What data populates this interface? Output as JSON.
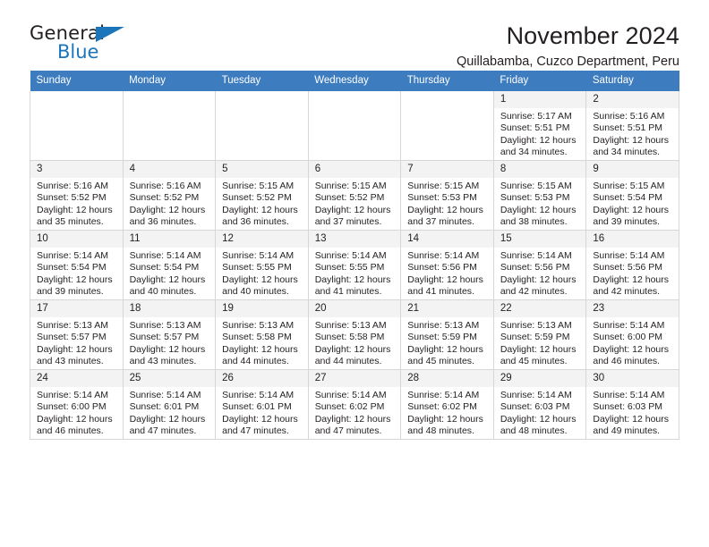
{
  "brand": {
    "word1": "General",
    "word2": "Blue",
    "triangle_color": "#1b75bb"
  },
  "header": {
    "title": "November 2024",
    "subtitle": "Quillabamba, Cuzco Department, Peru",
    "accent_color": "#3d7cbf"
  },
  "labels": {
    "sunrise_prefix": "Sunrise:",
    "sunset_prefix": "Sunset:",
    "daylight_prefix": "Daylight:"
  },
  "weekdays": [
    "Sunday",
    "Monday",
    "Tuesday",
    "Wednesday",
    "Thursday",
    "Friday",
    "Saturday"
  ],
  "weeks": [
    [
      null,
      null,
      null,
      null,
      null,
      {
        "day": "1",
        "sunrise": "Sunrise: 5:17 AM",
        "sunset": "Sunset: 5:51 PM",
        "daylight_l1": "Daylight: 12 hours",
        "daylight_l2": "and 34 minutes."
      },
      {
        "day": "2",
        "sunrise": "Sunrise: 5:16 AM",
        "sunset": "Sunset: 5:51 PM",
        "daylight_l1": "Daylight: 12 hours",
        "daylight_l2": "and 34 minutes."
      }
    ],
    [
      {
        "day": "3",
        "sunrise": "Sunrise: 5:16 AM",
        "sunset": "Sunset: 5:52 PM",
        "daylight_l1": "Daylight: 12 hours",
        "daylight_l2": "and 35 minutes."
      },
      {
        "day": "4",
        "sunrise": "Sunrise: 5:16 AM",
        "sunset": "Sunset: 5:52 PM",
        "daylight_l1": "Daylight: 12 hours",
        "daylight_l2": "and 36 minutes."
      },
      {
        "day": "5",
        "sunrise": "Sunrise: 5:15 AM",
        "sunset": "Sunset: 5:52 PM",
        "daylight_l1": "Daylight: 12 hours",
        "daylight_l2": "and 36 minutes."
      },
      {
        "day": "6",
        "sunrise": "Sunrise: 5:15 AM",
        "sunset": "Sunset: 5:52 PM",
        "daylight_l1": "Daylight: 12 hours",
        "daylight_l2": "and 37 minutes."
      },
      {
        "day": "7",
        "sunrise": "Sunrise: 5:15 AM",
        "sunset": "Sunset: 5:53 PM",
        "daylight_l1": "Daylight: 12 hours",
        "daylight_l2": "and 37 minutes."
      },
      {
        "day": "8",
        "sunrise": "Sunrise: 5:15 AM",
        "sunset": "Sunset: 5:53 PM",
        "daylight_l1": "Daylight: 12 hours",
        "daylight_l2": "and 38 minutes."
      },
      {
        "day": "9",
        "sunrise": "Sunrise: 5:15 AM",
        "sunset": "Sunset: 5:54 PM",
        "daylight_l1": "Daylight: 12 hours",
        "daylight_l2": "and 39 minutes."
      }
    ],
    [
      {
        "day": "10",
        "sunrise": "Sunrise: 5:14 AM",
        "sunset": "Sunset: 5:54 PM",
        "daylight_l1": "Daylight: 12 hours",
        "daylight_l2": "and 39 minutes."
      },
      {
        "day": "11",
        "sunrise": "Sunrise: 5:14 AM",
        "sunset": "Sunset: 5:54 PM",
        "daylight_l1": "Daylight: 12 hours",
        "daylight_l2": "and 40 minutes."
      },
      {
        "day": "12",
        "sunrise": "Sunrise: 5:14 AM",
        "sunset": "Sunset: 5:55 PM",
        "daylight_l1": "Daylight: 12 hours",
        "daylight_l2": "and 40 minutes."
      },
      {
        "day": "13",
        "sunrise": "Sunrise: 5:14 AM",
        "sunset": "Sunset: 5:55 PM",
        "daylight_l1": "Daylight: 12 hours",
        "daylight_l2": "and 41 minutes."
      },
      {
        "day": "14",
        "sunrise": "Sunrise: 5:14 AM",
        "sunset": "Sunset: 5:56 PM",
        "daylight_l1": "Daylight: 12 hours",
        "daylight_l2": "and 41 minutes."
      },
      {
        "day": "15",
        "sunrise": "Sunrise: 5:14 AM",
        "sunset": "Sunset: 5:56 PM",
        "daylight_l1": "Daylight: 12 hours",
        "daylight_l2": "and 42 minutes."
      },
      {
        "day": "16",
        "sunrise": "Sunrise: 5:14 AM",
        "sunset": "Sunset: 5:56 PM",
        "daylight_l1": "Daylight: 12 hours",
        "daylight_l2": "and 42 minutes."
      }
    ],
    [
      {
        "day": "17",
        "sunrise": "Sunrise: 5:13 AM",
        "sunset": "Sunset: 5:57 PM",
        "daylight_l1": "Daylight: 12 hours",
        "daylight_l2": "and 43 minutes."
      },
      {
        "day": "18",
        "sunrise": "Sunrise: 5:13 AM",
        "sunset": "Sunset: 5:57 PM",
        "daylight_l1": "Daylight: 12 hours",
        "daylight_l2": "and 43 minutes."
      },
      {
        "day": "19",
        "sunrise": "Sunrise: 5:13 AM",
        "sunset": "Sunset: 5:58 PM",
        "daylight_l1": "Daylight: 12 hours",
        "daylight_l2": "and 44 minutes."
      },
      {
        "day": "20",
        "sunrise": "Sunrise: 5:13 AM",
        "sunset": "Sunset: 5:58 PM",
        "daylight_l1": "Daylight: 12 hours",
        "daylight_l2": "and 44 minutes."
      },
      {
        "day": "21",
        "sunrise": "Sunrise: 5:13 AM",
        "sunset": "Sunset: 5:59 PM",
        "daylight_l1": "Daylight: 12 hours",
        "daylight_l2": "and 45 minutes."
      },
      {
        "day": "22",
        "sunrise": "Sunrise: 5:13 AM",
        "sunset": "Sunset: 5:59 PM",
        "daylight_l1": "Daylight: 12 hours",
        "daylight_l2": "and 45 minutes."
      },
      {
        "day": "23",
        "sunrise": "Sunrise: 5:14 AM",
        "sunset": "Sunset: 6:00 PM",
        "daylight_l1": "Daylight: 12 hours",
        "daylight_l2": "and 46 minutes."
      }
    ],
    [
      {
        "day": "24",
        "sunrise": "Sunrise: 5:14 AM",
        "sunset": "Sunset: 6:00 PM",
        "daylight_l1": "Daylight: 12 hours",
        "daylight_l2": "and 46 minutes."
      },
      {
        "day": "25",
        "sunrise": "Sunrise: 5:14 AM",
        "sunset": "Sunset: 6:01 PM",
        "daylight_l1": "Daylight: 12 hours",
        "daylight_l2": "and 47 minutes."
      },
      {
        "day": "26",
        "sunrise": "Sunrise: 5:14 AM",
        "sunset": "Sunset: 6:01 PM",
        "daylight_l1": "Daylight: 12 hours",
        "daylight_l2": "and 47 minutes."
      },
      {
        "day": "27",
        "sunrise": "Sunrise: 5:14 AM",
        "sunset": "Sunset: 6:02 PM",
        "daylight_l1": "Daylight: 12 hours",
        "daylight_l2": "and 47 minutes."
      },
      {
        "day": "28",
        "sunrise": "Sunrise: 5:14 AM",
        "sunset": "Sunset: 6:02 PM",
        "daylight_l1": "Daylight: 12 hours",
        "daylight_l2": "and 48 minutes."
      },
      {
        "day": "29",
        "sunrise": "Sunrise: 5:14 AM",
        "sunset": "Sunset: 6:03 PM",
        "daylight_l1": "Daylight: 12 hours",
        "daylight_l2": "and 48 minutes."
      },
      {
        "day": "30",
        "sunrise": "Sunrise: 5:14 AM",
        "sunset": "Sunset: 6:03 PM",
        "daylight_l1": "Daylight: 12 hours",
        "daylight_l2": "and 49 minutes."
      }
    ]
  ]
}
